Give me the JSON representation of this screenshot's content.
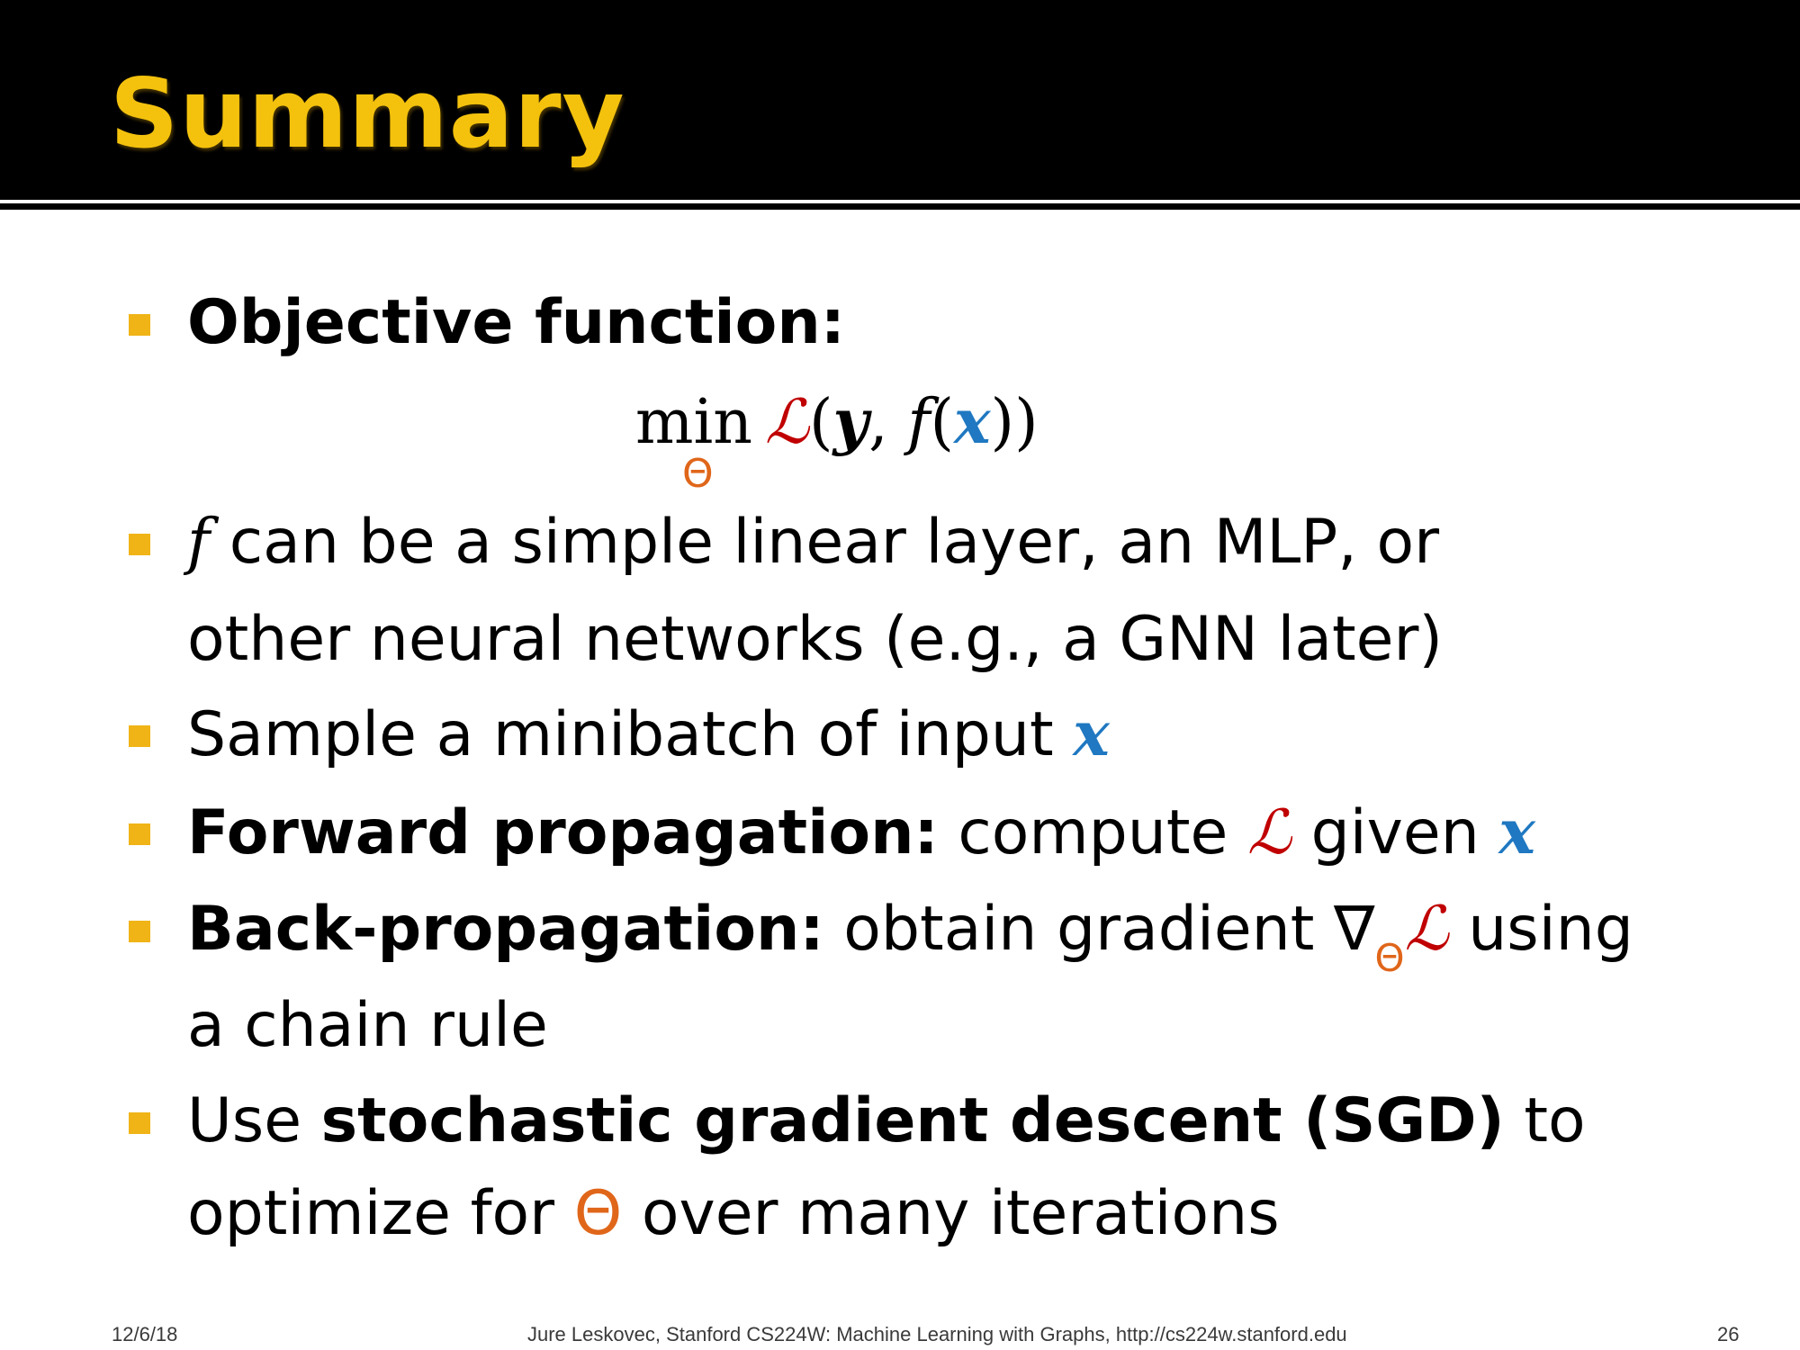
{
  "slide": {
    "title": "Summary"
  },
  "bullets": {
    "b1_bold": "Objective function:",
    "formula_min": "min",
    "formula_loss": "ℒ",
    "formula_open": "(",
    "formula_y": "y",
    "formula_comma": ", ",
    "formula_f": "f",
    "formula_open2": "(",
    "formula_x": "x",
    "formula_close": "))",
    "formula_theta": "Θ",
    "b2_f": "f",
    "b2_line1": " can be a simple linear layer, an MLP, or",
    "b2_line2": "other neural networks (e.g., a GNN later)",
    "b3_text": "Sample a minibatch of input ",
    "b3_x": "x",
    "b4_bold": "Forward propagation:",
    "b4_text": " compute ",
    "b4_loss": "ℒ",
    "b4_text2": " given ",
    "b4_x": "x",
    "b5_bold": "Back-propagation:",
    "b5_text": " obtain gradient ∇",
    "b5_theta": "Θ",
    "b5_loss": "ℒ",
    "b5_text2": " using",
    "b5_line2": "a chain rule",
    "b6_text": "Use ",
    "b6_bold": "stochastic gradient descent (SGD)",
    "b6_text2": " to",
    "b6_line2a": "optimize for ",
    "b6_theta": "Θ",
    "b6_line2b": " over many iterations"
  },
  "footer": {
    "date": "12/6/18",
    "credit": "Jure Leskovec, Stanford CS224W: Machine Learning with Graphs, http://cs224w.stanford.edu",
    "page": "26"
  },
  "colors": {
    "title": "#f4c20d",
    "bullet": "#f0b417",
    "loss": "#c00000",
    "input": "#1f78c1",
    "theta": "#e0661a"
  }
}
